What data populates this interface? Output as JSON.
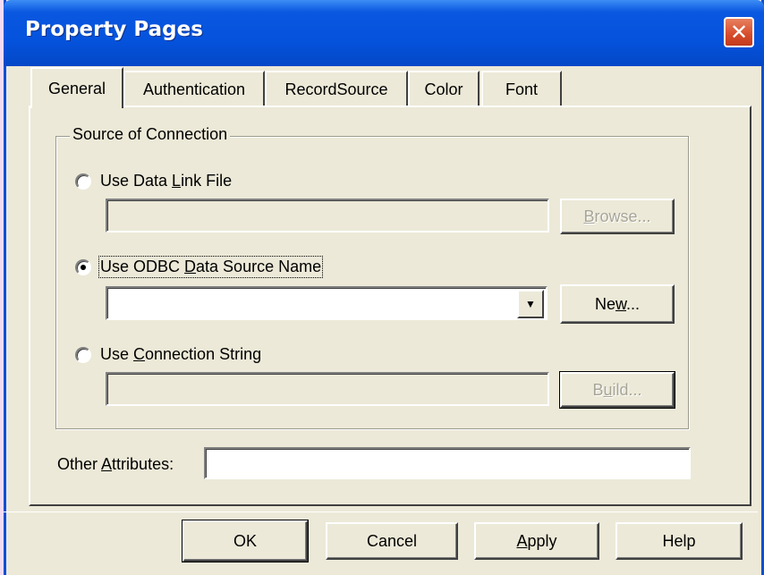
{
  "window": {
    "title": "Property Pages",
    "close_glyph": "✕"
  },
  "tabs": [
    {
      "label": "General",
      "active": true
    },
    {
      "label": "Authentication",
      "active": false
    },
    {
      "label": "RecordSource",
      "active": false
    },
    {
      "label": "Color",
      "active": false
    },
    {
      "label": "Font",
      "active": false
    }
  ],
  "group": {
    "label": "Source of Connection"
  },
  "options": {
    "data_link": {
      "pre": "Use Data ",
      "key": "L",
      "post": "ink File",
      "selected": false
    },
    "odbc": {
      "pre": "Use ODBC ",
      "key": "D",
      "post": "ata Source Name",
      "selected": true
    },
    "conn_string": {
      "pre": "Use ",
      "key": "C",
      "post": "onnection String",
      "selected": false
    }
  },
  "fields": {
    "data_link_value": "",
    "odbc_value": "",
    "conn_string_value": "",
    "other_attributes_value": ""
  },
  "buttons": {
    "browse": {
      "key": "B",
      "post": "rowse...",
      "enabled": false
    },
    "new": {
      "pre": "Ne",
      "key": "w",
      "post": "...",
      "enabled": true
    },
    "build": {
      "pre": "B",
      "key": "u",
      "post": "ild...",
      "enabled": false
    },
    "ok": "OK",
    "cancel": "Cancel",
    "apply": {
      "key": "A",
      "post": "pply"
    },
    "help": "Help"
  },
  "other_attributes": {
    "pre": "Other ",
    "key": "A",
    "post": "ttributes:"
  },
  "icons": {
    "close": "close-icon",
    "dropdown": "chevron-down-icon"
  }
}
